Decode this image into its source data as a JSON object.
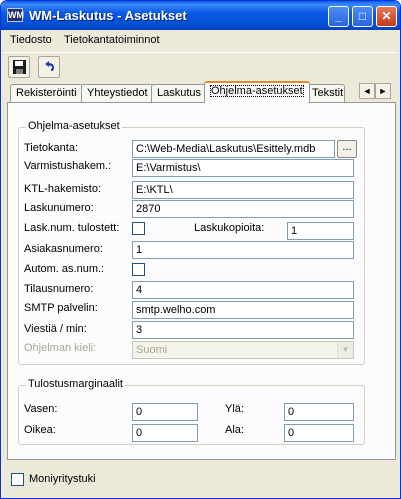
{
  "window": {
    "title": "WM-Laskutus - Asetukset",
    "app_icon_glyph": "WM",
    "minimize_glyph": "_",
    "maximize_glyph": "□",
    "close_glyph": "✕"
  },
  "menu": [
    "Tiedosto",
    "Tietokantatoiminnot"
  ],
  "toolbar": {
    "save_icon": "floppy-disk-icon",
    "undo_icon": "undo-arrow-icon"
  },
  "tabs": {
    "items": [
      "Rekisteröinti",
      "Yhteystiedot",
      "Laskutus",
      "Ohjelma-asetukset",
      "Tekstit"
    ],
    "active": "Ohjelma-asetukset",
    "scroll_left": "◄",
    "scroll_right": "►"
  },
  "program_settings": {
    "group_title": "Ohjelma-asetukset",
    "database_label": "Tietokanta:",
    "database_value": "C:\\Web-Media\\Laskutus\\Esittely.mdb",
    "browse_label": "...",
    "backup_dir_label": "Varmistushakem.:",
    "backup_dir_value": "E:\\Varmistus\\",
    "ktl_dir_label": "KTL-hakemisto:",
    "ktl_dir_value": "E:\\KTL\\",
    "invoice_number_label": "Laskunumero:",
    "invoice_number_value": "2870",
    "print_invoice_number_label": "Lask.num. tulostett:",
    "print_invoice_number_checked": false,
    "invoice_copies_label": "Laskukopioita:",
    "invoice_copies_value": "1",
    "customer_number_label": "Asiakasnumero:",
    "customer_number_value": "1",
    "auto_customer_number_label": "Autom. as.num.:",
    "auto_customer_number_checked": false,
    "order_number_label": "Tilausnumero:",
    "order_number_value": "4",
    "smtp_label": "SMTP palvelin:",
    "smtp_value": "smtp.welho.com",
    "messages_per_min_label": "Viestiä / min:",
    "messages_per_min_value": "3",
    "language_label": "Ohjelman kieli:",
    "language_value": "Suomi"
  },
  "print_margins": {
    "group_title": "Tulostusmarginaalit",
    "left_label": "Vasen:",
    "left_value": "0",
    "right_label": "Oikea:",
    "right_value": "0",
    "top_label": "Ylä:",
    "top_value": "0",
    "bottom_label": "Ala:",
    "bottom_value": "0"
  },
  "footer": {
    "multi_company_label": "Moniyritystuki",
    "multi_company_checked": false
  }
}
